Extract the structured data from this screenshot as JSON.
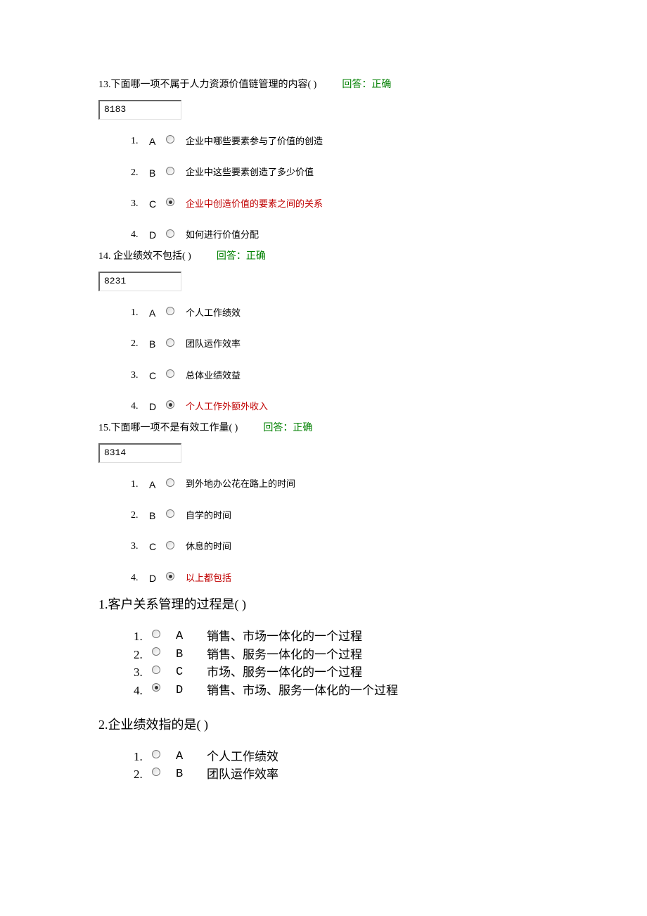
{
  "questions_small": [
    {
      "number": "13.",
      "text": "下面哪一项不属于人力资源价值链管理的内容( )",
      "status": "回答：正确",
      "id_box": "8183",
      "options": [
        {
          "num": "1.",
          "letter": "A",
          "text": "企业中哪些要素参与了价值的创造",
          "selected": false,
          "correct": false
        },
        {
          "num": "2.",
          "letter": "B",
          "text": "企业中这些要素创造了多少价值",
          "selected": false,
          "correct": false
        },
        {
          "num": "3.",
          "letter": "C",
          "text": "企业中创造价值的要素之间的关系",
          "selected": true,
          "correct": true
        },
        {
          "num": "4.",
          "letter": "D",
          "text": "如何进行价值分配",
          "selected": false,
          "correct": false
        }
      ]
    },
    {
      "number": "14.",
      "text": " 企业绩效不包括( )",
      "status": "回答：正确",
      "id_box": "8231",
      "options": [
        {
          "num": "1.",
          "letter": "A",
          "text": "个人工作绩效",
          "selected": false,
          "correct": false
        },
        {
          "num": "2.",
          "letter": "B",
          "text": "团队运作效率",
          "selected": false,
          "correct": false
        },
        {
          "num": "3.",
          "letter": "C",
          "text": "总体业绩效益",
          "selected": false,
          "correct": false
        },
        {
          "num": "4.",
          "letter": "D",
          "text": "个人工作外额外收入",
          "selected": true,
          "correct": true
        }
      ]
    },
    {
      "number": "15.",
      "text": "下面哪一项不是有效工作量( )",
      "status": "回答：正确",
      "id_box": "8314",
      "options": [
        {
          "num": "1.",
          "letter": "A",
          "text": "到外地办公花在路上的时间",
          "selected": false,
          "correct": false
        },
        {
          "num": "2.",
          "letter": "B",
          "text": "自学的时间",
          "selected": false,
          "correct": false
        },
        {
          "num": "3.",
          "letter": "C",
          "text": "休息的时间",
          "selected": false,
          "correct": false
        },
        {
          "num": "4.",
          "letter": "D",
          "text": "以上都包括",
          "selected": true,
          "correct": true
        }
      ]
    }
  ],
  "questions_large": [
    {
      "number": "1.",
      "text": "客户关系管理的过程是( )",
      "options": [
        {
          "num": "1.",
          "letter": "A",
          "text": "销售、市场一体化的一个过程",
          "selected": false
        },
        {
          "num": "2.",
          "letter": "B",
          "text": " 销售、服务一体化的一个过程",
          "selected": false
        },
        {
          "num": "3.",
          "letter": "C",
          "text": "市场、服务一体化的一个过程",
          "selected": false
        },
        {
          "num": "4.",
          "letter": "D",
          "text": "销售、市场、服务一体化的一个过程",
          "selected": true
        }
      ]
    },
    {
      "number": "2.",
      "text": "企业绩效指的是( )",
      "options": [
        {
          "num": "1.",
          "letter": "A",
          "text": "个人工作绩效",
          "selected": false
        },
        {
          "num": "2.",
          "letter": "B",
          "text": " 团队运作效率",
          "selected": false
        }
      ]
    }
  ]
}
